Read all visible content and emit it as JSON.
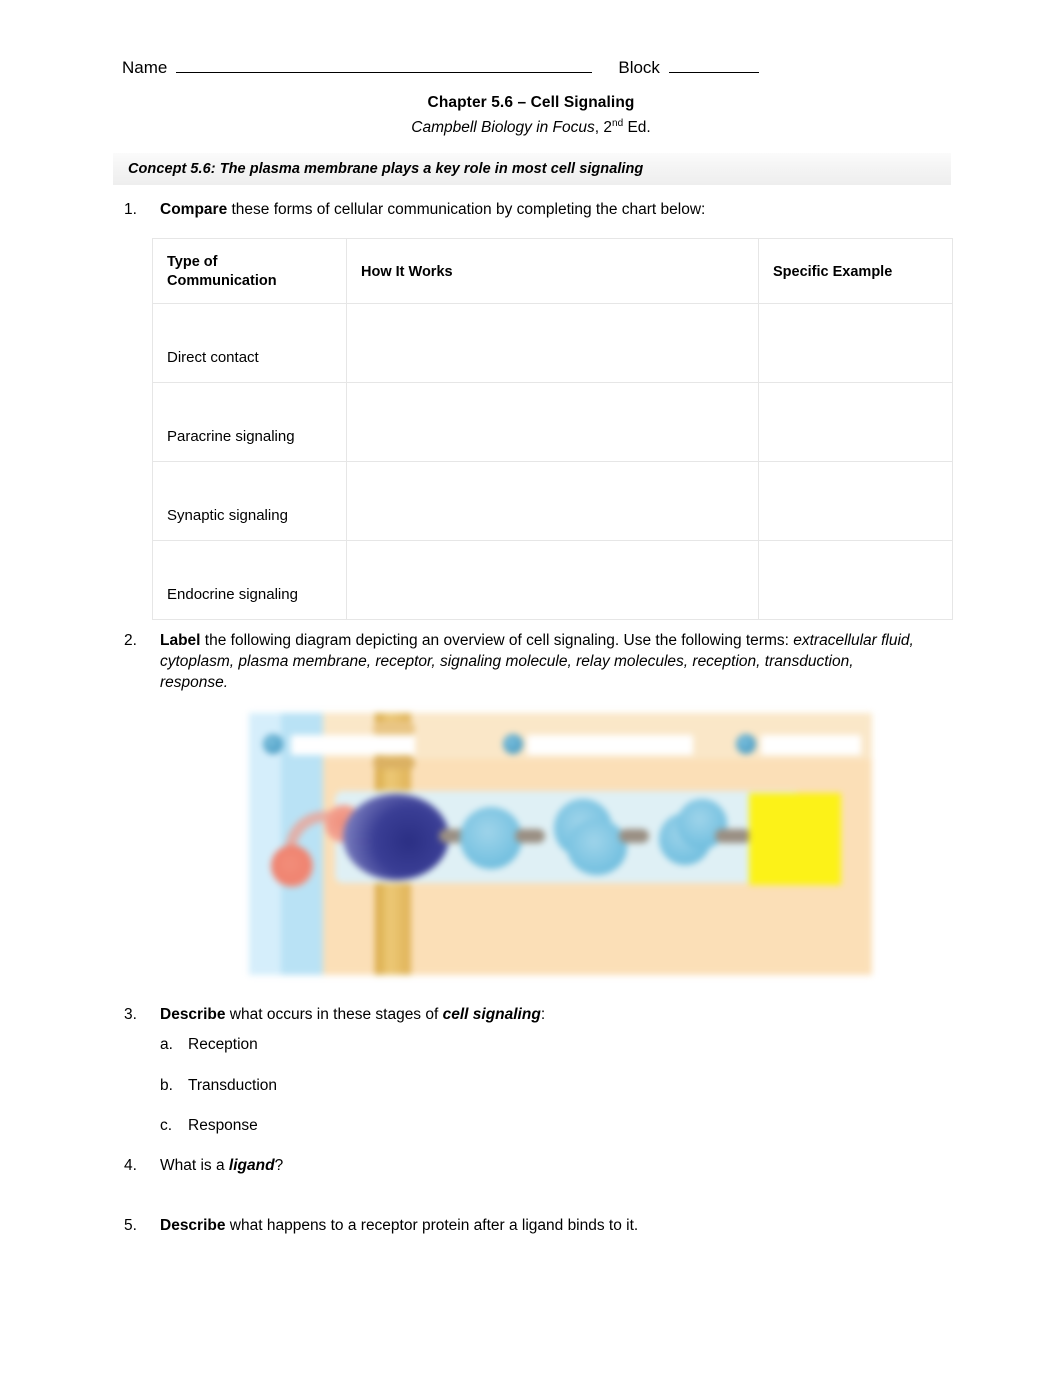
{
  "header": {
    "name_label": "Name",
    "block_label": "Block"
  },
  "title": {
    "main": "Chapter 5.6 – Cell Signaling",
    "book": "Campbell Biology in Focus",
    "edition_sep": ", 2",
    "edition_sup": "nd",
    "edition_end": " Ed."
  },
  "concept": {
    "text": "Concept 5.6: The plasma membrane plays a key role in most cell signaling"
  },
  "questions": {
    "q1": {
      "number": "1.",
      "bold": "Compare",
      "rest": " these forms of cellular communication by completing the chart below:"
    },
    "q2": {
      "number": "2.",
      "bold": "Label",
      "rest": " the following diagram depicting an overview of cell signaling. Use the following terms:",
      "terms": "extracellular fluid, cytoplasm, plasma membrane, receptor, signaling molecule, relay molecules, reception, transduction, response."
    },
    "q3": {
      "number": "3.",
      "bold": "Describe",
      "mid": " what occurs in these stages of ",
      "bold_italic": "cell signaling",
      "end": ":",
      "sub": [
        {
          "letter": "a.",
          "text": "Reception"
        },
        {
          "letter": "b.",
          "text": "Transduction"
        },
        {
          "letter": "c.",
          "text": "Response"
        }
      ]
    },
    "q4": {
      "number": "4.",
      "pre": "What is a ",
      "bold_italic": "ligand",
      "end": "?"
    },
    "q5": {
      "number": "5.",
      "bold": "Describe",
      "rest": " what happens to a receptor protein after a ligand binds to it."
    }
  },
  "table": {
    "headers": [
      "Type of Communication",
      "How It Works",
      "Specific Example"
    ],
    "header_col1_line1": "Type of",
    "header_col1_line2": "Communication",
    "rows": [
      {
        "type": "Direct contact",
        "how": "",
        "example": ""
      },
      {
        "type": "Paracrine signaling",
        "how": "",
        "example": ""
      },
      {
        "type": "Synaptic signaling",
        "how": "",
        "example": ""
      },
      {
        "type": "Endocrine signaling",
        "how": "",
        "example": ""
      }
    ]
  },
  "figure": {
    "caption": "",
    "parts": {
      "extracellular_fluid": "extracellular fluid",
      "plasma_membrane": "plasma membrane",
      "cytoplasm": "cytoplasm",
      "receptor": "receptor",
      "signaling_molecule": "signaling molecule",
      "relay_molecules": "relay molecules",
      "response": "response"
    },
    "stage_markers": [
      "1",
      "2",
      "3"
    ],
    "stage_labels_blank": [
      "",
      "",
      ""
    ],
    "colors": {
      "extracellular_fluid": "#b9e2f5",
      "cytoplasm": "#fbdfb7",
      "plasma_membrane": "#e0b558",
      "receptor": "#2b2f84",
      "signaling_molecule": "#ef8370",
      "relay_molecule": "#7cc4e2",
      "response_box": "#fcf218",
      "transduction_strip": "#dff0f5"
    }
  },
  "colors": {
    "page_background": "#ffffff",
    "text": "#000000",
    "banner_background": "#f1f1f1",
    "table_border": "#e6e6e6"
  }
}
